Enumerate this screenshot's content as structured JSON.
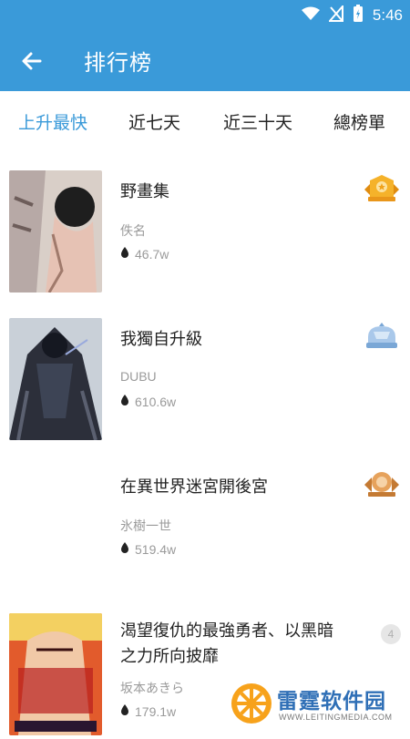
{
  "status": {
    "time": "5:46"
  },
  "header": {
    "title": "排行榜",
    "back_icon": "arrow-left-icon"
  },
  "tabs": [
    {
      "label": "上升最快",
      "active": true
    },
    {
      "label": "近七天",
      "active": false
    },
    {
      "label": "近三十天",
      "active": false
    },
    {
      "label": "總榜單",
      "active": false
    }
  ],
  "items": [
    {
      "title": "野畫集",
      "author": "佚名",
      "views": "46.7w",
      "rank": 1,
      "badge": "gold-medal-icon"
    },
    {
      "title": "我獨自升級",
      "author": "DUBU",
      "views": "610.6w",
      "rank": 2,
      "badge": "silver-medal-icon"
    },
    {
      "title": "在異世界迷宮開後宮",
      "author": "氷樹一世",
      "views": "519.4w",
      "rank": 3,
      "badge": "bronze-medal-icon"
    },
    {
      "title_line1": "渴望復仇的最強勇者、以黑暗",
      "title_line2": "之力所向披靡",
      "author": "坂本あきら",
      "views": "179.1w",
      "rank": "4",
      "badge": "rank-number"
    }
  ],
  "watermark": {
    "name": "雷霆软件园",
    "url": "WWW.LEITINGMEDIA.COM"
  },
  "colors": {
    "primary": "#3a9ad9",
    "gold": "#f0a21c",
    "silver": "#8fb7e0",
    "bronze": "#d9934a"
  }
}
